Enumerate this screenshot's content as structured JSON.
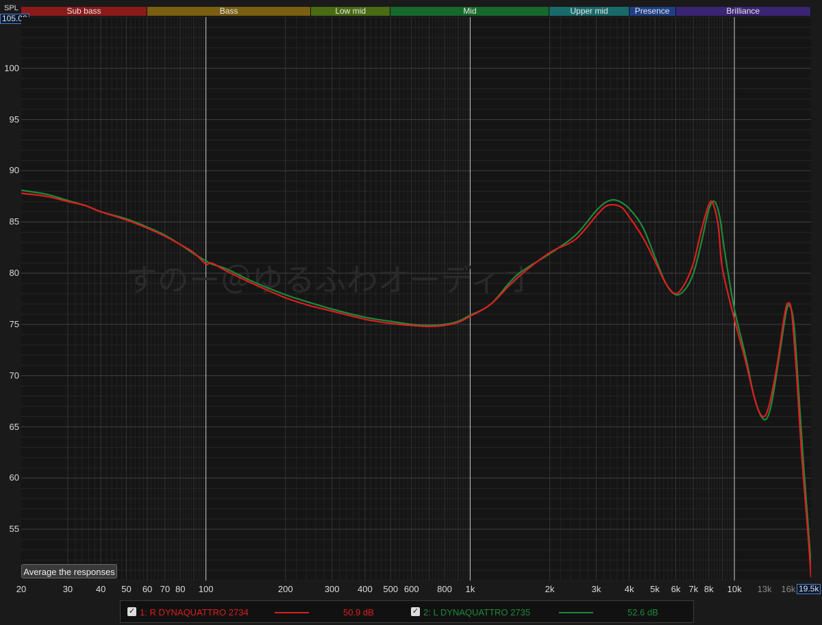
{
  "header": {
    "y_unit_label": "SPL",
    "y_top_value": "105.00",
    "x_right_value": "19.5k"
  },
  "bands": [
    {
      "label": "Sub bass",
      "from": 20,
      "to": 60,
      "color": "#8b1a1a"
    },
    {
      "label": "Bass",
      "from": 60,
      "to": 250,
      "color": "#7a5f12"
    },
    {
      "label": "Low mid",
      "from": 250,
      "to": 500,
      "color": "#4a6a14"
    },
    {
      "label": "Mid",
      "from": 500,
      "to": 2000,
      "color": "#17682b"
    },
    {
      "label": "Upper mid",
      "from": 2000,
      "to": 4000,
      "color": "#196b6a"
    },
    {
      "label": "Presence",
      "from": 4000,
      "to": 6000,
      "color": "#1f3f86"
    },
    {
      "label": "Brilliance",
      "from": 6000,
      "to": 20000,
      "color": "#3a2473"
    }
  ],
  "watermark": "すのー＠ゆるふわオーディオ",
  "average_button": "Average the responses",
  "legend": [
    {
      "check": "✓",
      "label": "1: R DYNAQUATTRO 2734",
      "value": "50.9 dB",
      "color": "#dd1f1f"
    },
    {
      "check": "✓",
      "label": "2: L DYNAQUATTRO 2735",
      "value": "52.6 dB",
      "color": "#1f8a3a"
    }
  ],
  "chart_data": {
    "type": "line",
    "x_scale": "log",
    "xlim": [
      20,
      19500
    ],
    "ylim": [
      50,
      105
    ],
    "ylabel": "SPL",
    "yticks": [
      55,
      60,
      65,
      70,
      75,
      80,
      85,
      90,
      95,
      100
    ],
    "xticks": [
      {
        "v": 20,
        "label": "20"
      },
      {
        "v": 30,
        "label": "30"
      },
      {
        "v": 40,
        "label": "40"
      },
      {
        "v": 50,
        "label": "50"
      },
      {
        "v": 60,
        "label": "60"
      },
      {
        "v": 70,
        "label": "70"
      },
      {
        "v": 80,
        "label": "80"
      },
      {
        "v": 100,
        "label": "100"
      },
      {
        "v": 200,
        "label": "200"
      },
      {
        "v": 300,
        "label": "300"
      },
      {
        "v": 400,
        "label": "400"
      },
      {
        "v": 500,
        "label": "500"
      },
      {
        "v": 600,
        "label": "600"
      },
      {
        "v": 800,
        "label": "800"
      },
      {
        "v": 1000,
        "label": "1k"
      },
      {
        "v": 2000,
        "label": "2k"
      },
      {
        "v": 3000,
        "label": "3k"
      },
      {
        "v": 4000,
        "label": "4k"
      },
      {
        "v": 5000,
        "label": "5k"
      },
      {
        "v": 6000,
        "label": "6k"
      },
      {
        "v": 7000,
        "label": "7k"
      },
      {
        "v": 8000,
        "label": "8k"
      },
      {
        "v": 10000,
        "label": "10k"
      },
      {
        "v": 13000,
        "label": "13k"
      },
      {
        "v": 16000,
        "label": "16k"
      }
    ],
    "grid": true,
    "series": [
      {
        "name": "1: R DYNAQUATTRO 2734",
        "color": "#dd1f1f",
        "points": [
          [
            20,
            87.8
          ],
          [
            25,
            87.5
          ],
          [
            30,
            87.0
          ],
          [
            35,
            86.6
          ],
          [
            40,
            86.0
          ],
          [
            50,
            85.2
          ],
          [
            60,
            84.4
          ],
          [
            70,
            83.6
          ],
          [
            80,
            82.8
          ],
          [
            90,
            82.0
          ],
          [
            100,
            80.9
          ],
          [
            105,
            81.0
          ],
          [
            120,
            80.2
          ],
          [
            150,
            79.0
          ],
          [
            200,
            77.6
          ],
          [
            250,
            76.8
          ],
          [
            300,
            76.3
          ],
          [
            400,
            75.5
          ],
          [
            500,
            75.1
          ],
          [
            600,
            74.9
          ],
          [
            700,
            74.8
          ],
          [
            800,
            74.9
          ],
          [
            900,
            75.2
          ],
          [
            1000,
            75.8
          ],
          [
            1200,
            77.0
          ],
          [
            1500,
            79.5
          ],
          [
            2000,
            82.0
          ],
          [
            2500,
            83.3
          ],
          [
            3000,
            85.6
          ],
          [
            3300,
            86.6
          ],
          [
            3700,
            86.5
          ],
          [
            4000,
            85.5
          ],
          [
            4500,
            83.5
          ],
          [
            5000,
            81.2
          ],
          [
            5500,
            79.0
          ],
          [
            6000,
            78.0
          ],
          [
            6500,
            79.0
          ],
          [
            7000,
            81.0
          ],
          [
            7500,
            84.2
          ],
          [
            8000,
            86.7
          ],
          [
            8300,
            86.8
          ],
          [
            8700,
            84.5
          ],
          [
            9000,
            80.5
          ],
          [
            10000,
            75.5
          ],
          [
            11000,
            71.5
          ],
          [
            12000,
            67.5
          ],
          [
            12800,
            66.0
          ],
          [
            13500,
            67.0
          ],
          [
            14500,
            71.0
          ],
          [
            15500,
            76.0
          ],
          [
            16000,
            77.1
          ],
          [
            16500,
            76.0
          ],
          [
            17200,
            70.0
          ],
          [
            18000,
            62.0
          ],
          [
            19000,
            54.5
          ],
          [
            19500,
            50.3
          ]
        ]
      },
      {
        "name": "2: L DYNAQUATTRO 2735",
        "color": "#1f8a3a",
        "points": [
          [
            20,
            88.1
          ],
          [
            25,
            87.7
          ],
          [
            30,
            87.1
          ],
          [
            35,
            86.6
          ],
          [
            40,
            86.0
          ],
          [
            50,
            85.3
          ],
          [
            60,
            84.5
          ],
          [
            70,
            83.7
          ],
          [
            80,
            82.8
          ],
          [
            90,
            81.9
          ],
          [
            100,
            81.2
          ],
          [
            105,
            80.9
          ],
          [
            120,
            80.4
          ],
          [
            150,
            79.2
          ],
          [
            200,
            77.9
          ],
          [
            250,
            77.1
          ],
          [
            300,
            76.5
          ],
          [
            400,
            75.7
          ],
          [
            500,
            75.3
          ],
          [
            600,
            75.0
          ],
          [
            700,
            74.9
          ],
          [
            800,
            75.0
          ],
          [
            900,
            75.3
          ],
          [
            1000,
            75.9
          ],
          [
            1200,
            77.0
          ],
          [
            1500,
            79.8
          ],
          [
            2000,
            81.9
          ],
          [
            2500,
            83.7
          ],
          [
            3000,
            86.1
          ],
          [
            3300,
            87.0
          ],
          [
            3600,
            87.1
          ],
          [
            4000,
            86.3
          ],
          [
            4500,
            84.5
          ],
          [
            5000,
            81.6
          ],
          [
            5500,
            79.0
          ],
          [
            6000,
            77.9
          ],
          [
            6500,
            78.4
          ],
          [
            7000,
            80.0
          ],
          [
            7500,
            83.0
          ],
          [
            8000,
            86.2
          ],
          [
            8400,
            87.0
          ],
          [
            8800,
            85.5
          ],
          [
            9200,
            82.0
          ],
          [
            10000,
            76.5
          ],
          [
            11000,
            72.0
          ],
          [
            12000,
            67.5
          ],
          [
            13000,
            65.7
          ],
          [
            13800,
            67.2
          ],
          [
            14800,
            72.0
          ],
          [
            15700,
            76.2
          ],
          [
            16200,
            76.8
          ],
          [
            16800,
            75.0
          ],
          [
            17500,
            68.5
          ],
          [
            18300,
            61.0
          ],
          [
            19000,
            55.5
          ],
          [
            19500,
            51.5
          ]
        ]
      }
    ]
  }
}
